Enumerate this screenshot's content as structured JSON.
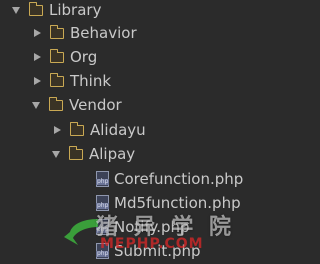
{
  "tree": [
    {
      "label": "Library",
      "state": "open",
      "type": "folder",
      "depth": 0
    },
    {
      "label": "Behavior",
      "state": "closed",
      "type": "folder",
      "depth": 1
    },
    {
      "label": "Org",
      "state": "closed",
      "type": "folder",
      "depth": 1
    },
    {
      "label": "Think",
      "state": "closed",
      "type": "folder",
      "depth": 1
    },
    {
      "label": "Vendor",
      "state": "open",
      "type": "folder",
      "depth": 1
    },
    {
      "label": "Alidayu",
      "state": "closed",
      "type": "folder",
      "depth": 2
    },
    {
      "label": "Alipay",
      "state": "open",
      "type": "folder",
      "depth": 2
    },
    {
      "label": "Corefunction.php",
      "type": "php-file",
      "depth": 3
    },
    {
      "label": "Md5function.php",
      "type": "php-file",
      "depth": 3
    },
    {
      "label": "Notify.php",
      "type": "php-file",
      "depth": 3
    },
    {
      "label": "Submit.php",
      "type": "php-file",
      "depth": 3
    }
  ],
  "watermark": {
    "text_cn": "猪 异 学 院",
    "text_en": "MEPHP.COM"
  },
  "colors": {
    "background": "#2b2b2b",
    "text": "#c9c9c9",
    "folder": "#c9a954",
    "php_icon": "#6a7396",
    "watermark_en": "#dc2828",
    "watermark_arrow": "#3db33d"
  }
}
